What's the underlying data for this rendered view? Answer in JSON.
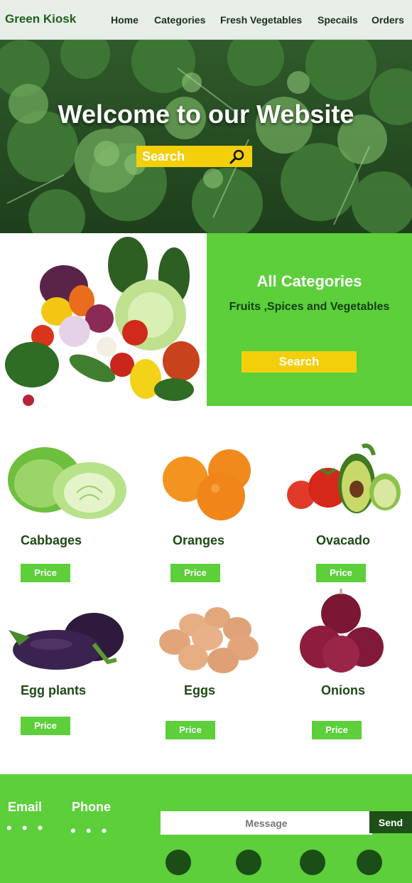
{
  "nav": {
    "brand": "Green Kiosk",
    "links": [
      "Home",
      "Categories",
      "Fresh Vegetables",
      "Specails",
      "Orders"
    ]
  },
  "hero": {
    "title": "Welcome to our Website",
    "search_placeholder": "Search"
  },
  "categories": {
    "title": "All Categories",
    "subtitle": "Fruits ,Spices and Vegetables",
    "search_label": "Search"
  },
  "products": [
    {
      "name": "Cabbages",
      "price_label": "Price"
    },
    {
      "name": "Oranges",
      "price_label": "Price"
    },
    {
      "name": "Ovacado",
      "price_label": "Price"
    },
    {
      "name": "Egg plants",
      "price_label": "Price"
    },
    {
      "name": "Eggs",
      "price_label": "Price"
    },
    {
      "name": "Onions",
      "price_label": "Price"
    }
  ],
  "footer": {
    "email_label": "Email",
    "email_value": "• • •",
    "phone_label": "Phone",
    "phone_value": "• • •",
    "message_placeholder": "Message",
    "send_label": "Send"
  },
  "colors": {
    "accent_green": "#5ccf3b",
    "yellow": "#f2cf0a",
    "dark_green": "#1b4d17"
  }
}
